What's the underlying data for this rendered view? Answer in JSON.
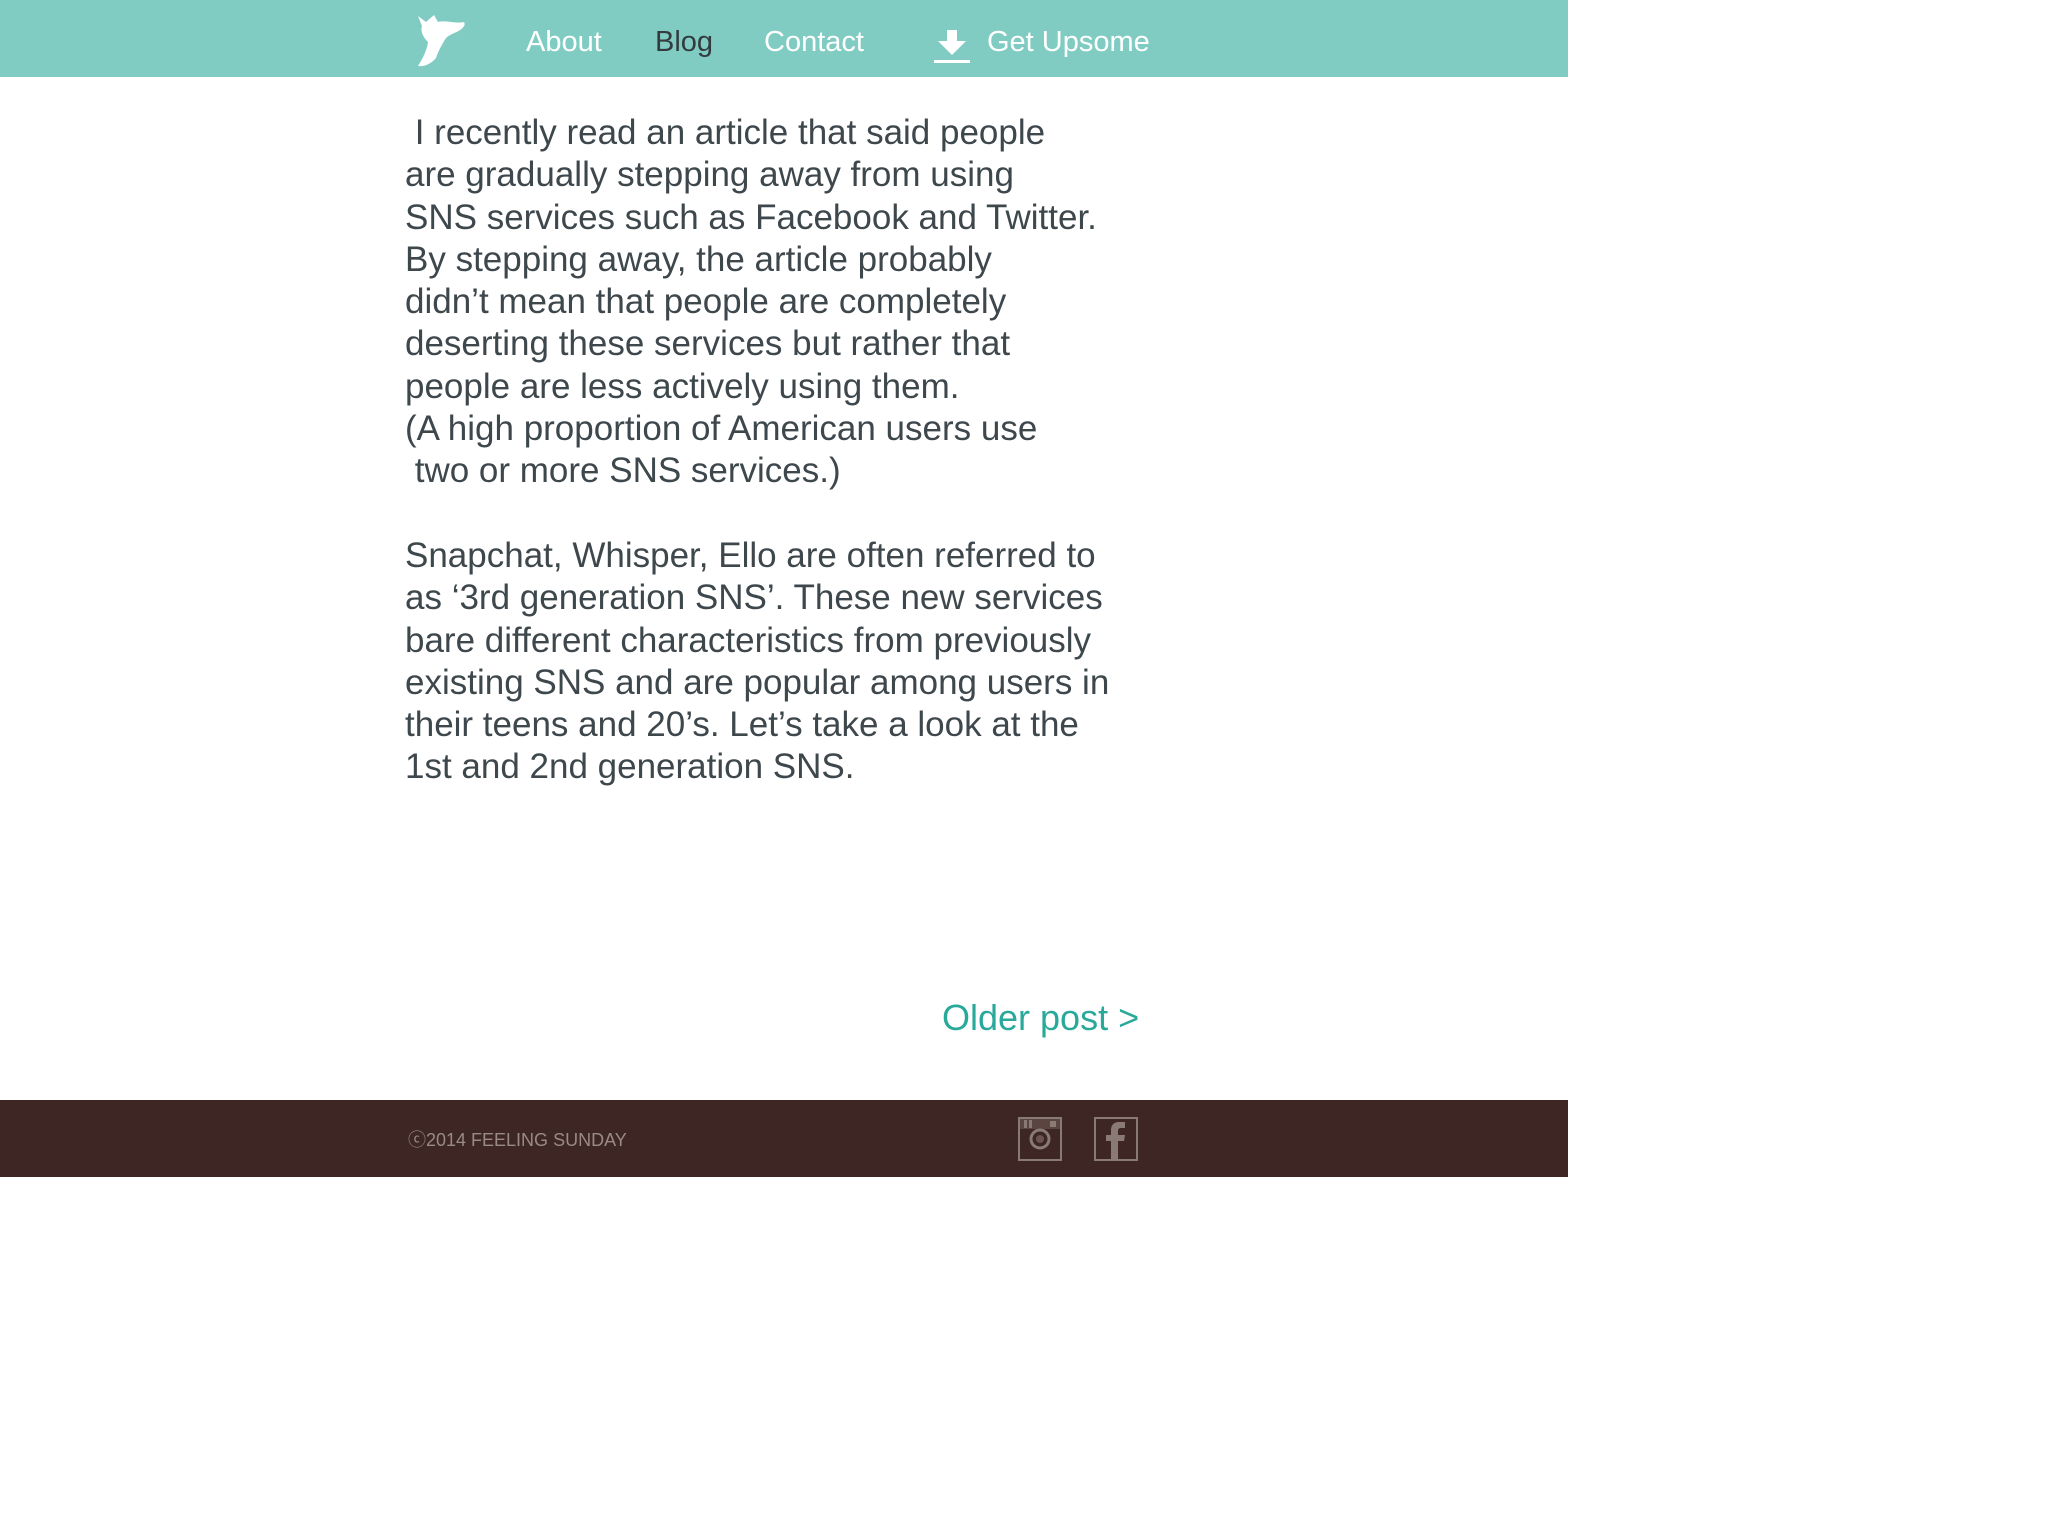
{
  "header": {
    "logo_icon": "goat-head-logo-icon",
    "nav": {
      "about": "About",
      "blog": "Blog",
      "contact": "Contact"
    },
    "download": {
      "icon": "download-icon",
      "label": "Get Upsome"
    }
  },
  "article": {
    "paragraph1": [
      " I recently read an article that said people",
      "are gradually stepping away from using",
      "SNS services such as Facebook and Twitter.",
      "By stepping away, the article probably",
      "didn’t mean that people are completely",
      "deserting these services but rather that",
      "people are less actively using them.",
      "(A high proportion of American users use",
      " two or more SNS services.)"
    ],
    "paragraph2": [
      "Snapchat, Whisper, Ello are often referred to",
      "as ‘3rd generation SNS’. These new services",
      "bare different characteristics from previously",
      "existing SNS and are popular among users in",
      "their teens and 20’s. Let’s take a look at the",
      "1st and 2nd generation SNS."
    ]
  },
  "pagination": {
    "older_label": "Older post >"
  },
  "footer": {
    "copyright": "ⓒ2014 FEELING SUNDAY",
    "social_icons": [
      "instagram-icon",
      "facebook-icon"
    ]
  },
  "colors": {
    "header_bg": "#80ccc3",
    "footer_bg": "#3d2624",
    "accent": "#29a99a",
    "body_text": "#3d474c"
  }
}
